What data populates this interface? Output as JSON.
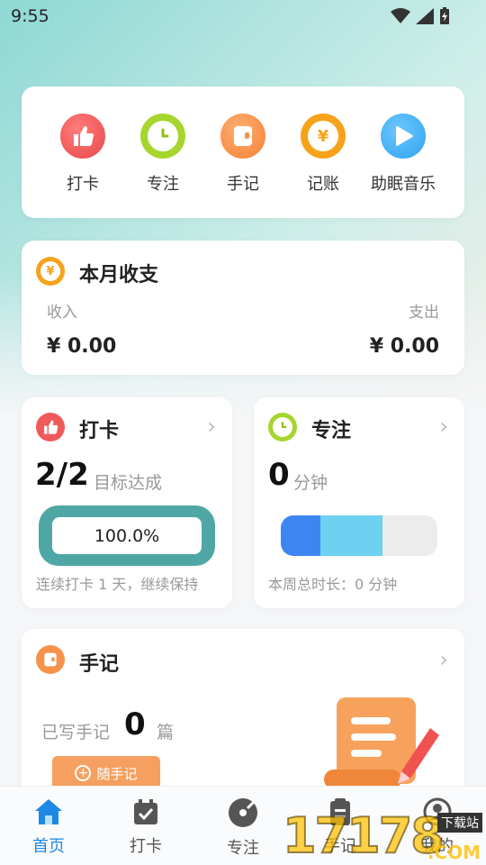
{
  "status": {
    "time": "9:55"
  },
  "quick_menu": [
    {
      "label": "打卡",
      "icon": "thumbs-up-icon",
      "color": "#f05a5a"
    },
    {
      "label": "专注",
      "icon": "clock-icon",
      "color": "#a6d62e"
    },
    {
      "label": "手记",
      "icon": "wallet-icon",
      "color": "#f7924a"
    },
    {
      "label": "记账",
      "icon": "yen-coin-icon",
      "color": "#f6a21a"
    },
    {
      "label": "助眠音乐",
      "icon": "play-icon",
      "color": "#3bb0f0"
    }
  ],
  "income": {
    "title": "本月收支",
    "income_label": "收入",
    "expense_label": "支出",
    "income_value": "¥ 0.00",
    "expense_value": "¥ 0.00"
  },
  "checkin": {
    "title": "打卡",
    "count": "2/2",
    "count_label": "目标达成",
    "progress_text": "100.0%",
    "progress": 1.0,
    "footer": "连续打卡 1 天，继续保持"
  },
  "focus": {
    "title": "专注",
    "value": "0",
    "unit": "分钟",
    "footer": "本周总时长：0 分钟"
  },
  "notes": {
    "title": "手记",
    "written_label": "已写手记",
    "written_count": "0",
    "written_unit": "篇",
    "button_label": "随手记"
  },
  "bottom_nav": [
    {
      "label": "首页",
      "icon": "home-icon",
      "active": true
    },
    {
      "label": "打卡",
      "icon": "calendar-check-icon",
      "active": false
    },
    {
      "label": "专注",
      "icon": "disc-icon",
      "active": false
    },
    {
      "label": "手记",
      "icon": "notebook-icon",
      "active": false
    },
    {
      "label": "我的",
      "icon": "user-icon",
      "active": false
    }
  ],
  "watermark": "17178 下载站 .COM"
}
